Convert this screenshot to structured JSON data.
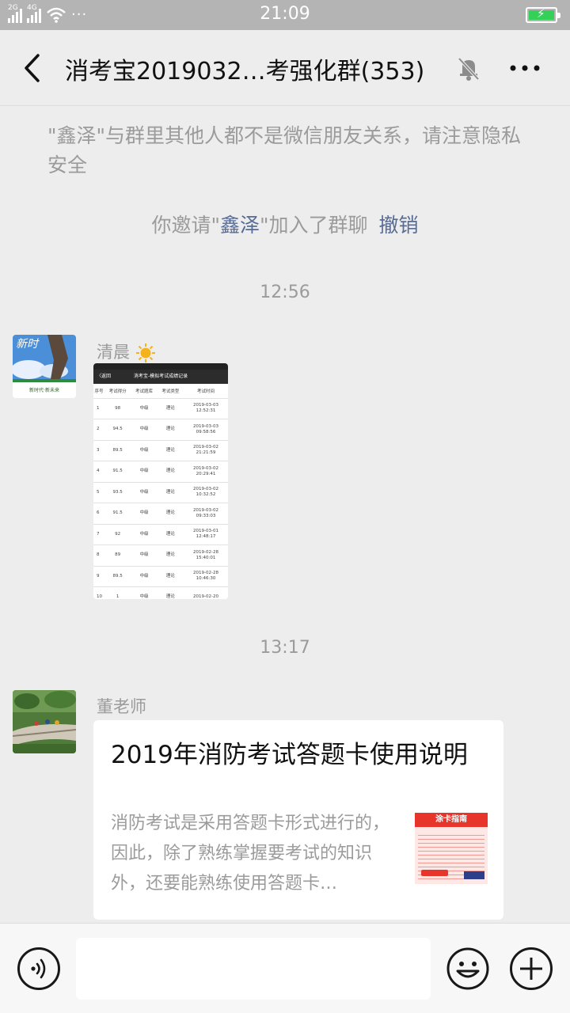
{
  "status_bar": {
    "signal1": "2G",
    "signal2": "4G",
    "more": "···",
    "time": "21:09"
  },
  "nav": {
    "title": "消考宝2019032…考强化群(353)"
  },
  "chat": {
    "notice": "\"鑫泽\"与群里其他人都不是微信朋友关系，请注意隐私安全",
    "invite_prefix": "你邀请\"",
    "invite_name": "鑫泽",
    "invite_suffix": "\"加入了群聊",
    "revoke": "撤销",
    "messages": [
      {
        "time": "12:56",
        "sender": "清晨",
        "avatar_text": "新时",
        "avatar_caption": "新时代·新未来",
        "screenshot": {
          "back": "〈返回",
          "title": "消考宝-模拟考试成绩记录",
          "headers": [
            "序号",
            "考试得分",
            "考试题库",
            "考试类型",
            "考试时间"
          ],
          "rows": [
            [
              "1",
              "98",
              "中级",
              "理论",
              "2019-03-03",
              "12:52:31"
            ],
            [
              "2",
              "94.5",
              "中级",
              "理论",
              "2019-03-03",
              "09:58:56"
            ],
            [
              "3",
              "89.5",
              "中级",
              "理论",
              "2019-03-02",
              "21:21:59"
            ],
            [
              "4",
              "91.5",
              "中级",
              "理论",
              "2019-03-02",
              "20:29:41"
            ],
            [
              "5",
              "93.5",
              "中级",
              "理论",
              "2019-03-02",
              "10:32:52"
            ],
            [
              "6",
              "91.5",
              "中级",
              "理论",
              "2019-03-02",
              "09:33:03"
            ],
            [
              "7",
              "92",
              "中级",
              "理论",
              "2019-03-01",
              "12:48:17"
            ],
            [
              "8",
              "89",
              "中级",
              "理论",
              "2019-02-28",
              "15:40:01"
            ],
            [
              "9",
              "89.5",
              "中级",
              "理论",
              "2019-02-28",
              "10:46:30"
            ],
            [
              "10",
              "1",
              "中级",
              "理论",
              "2019-02-20",
              ""
            ]
          ]
        }
      },
      {
        "time": "13:17",
        "sender": "董老师",
        "card": {
          "title": "2019年消防考试答题卡使用说明",
          "description": "消防考试是采用答题卡形式进行的，因此，除了熟练掌握要考试的知识外，还要能熟练使用答题卡…",
          "thumb_title": "涂卡指南"
        }
      }
    ]
  },
  "input": {
    "placeholder": ""
  },
  "colors": {
    "link": "#576b95",
    "meta_text": "#9b9b9b",
    "status_bar": "#b4b4b4",
    "background": "#ededed"
  }
}
